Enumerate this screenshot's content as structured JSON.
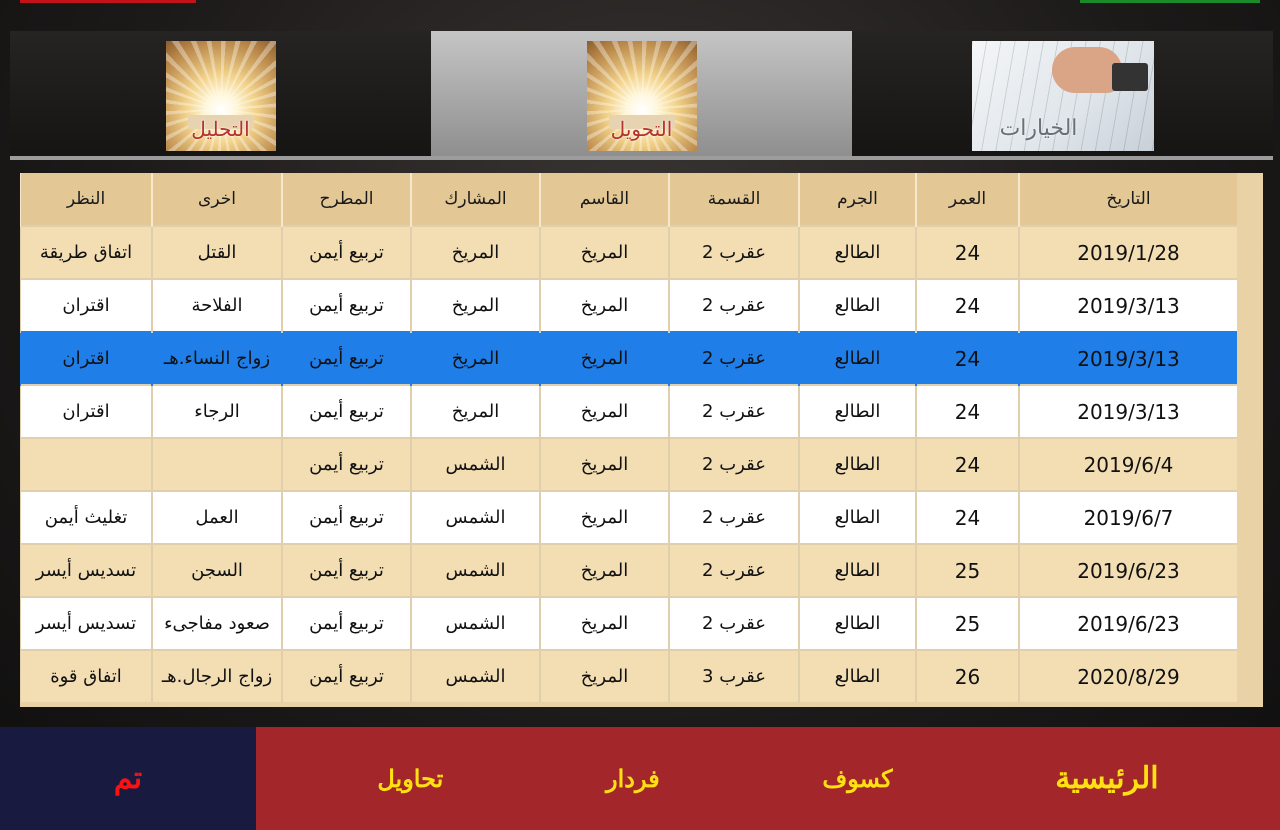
{
  "tabs": [
    {
      "label": "التحليل",
      "icon": "book-light-icon"
    },
    {
      "label": "التحويل",
      "icon": "book-light-icon"
    },
    {
      "label": "الخيارات",
      "icon": "drafting-hands-icon"
    }
  ],
  "table": {
    "columns": [
      "التاريخ",
      "العمر",
      "الجرم",
      "القسمة",
      "القاسم",
      "المشارك",
      "المطرح",
      "اخرى",
      "النظر"
    ],
    "rows": [
      [
        "2019/1/28",
        "24",
        "الطالع",
        "عقرب 2",
        "المريخ",
        "المريخ",
        "تربيع أيمن",
        "القتل",
        "اتفاق طريقة"
      ],
      [
        "2019/3/13",
        "24",
        "الطالع",
        "عقرب 2",
        "المريخ",
        "المريخ",
        "تربيع أيمن",
        "الفلاحة",
        "اقتران"
      ],
      [
        "2019/3/13",
        "24",
        "الطالع",
        "عقرب 2",
        "المريخ",
        "المريخ",
        "تربيع أيمن",
        "زواج النساء.هـ",
        "اقتران"
      ],
      [
        "2019/3/13",
        "24",
        "الطالع",
        "عقرب 2",
        "المريخ",
        "المريخ",
        "تربيع أيمن",
        "الرجاء",
        "اقتران"
      ],
      [
        "2019/6/4",
        "24",
        "الطالع",
        "عقرب 2",
        "المريخ",
        "الشمس",
        "تربيع أيمن",
        "",
        ""
      ],
      [
        "2019/6/7",
        "24",
        "الطالع",
        "عقرب 2",
        "المريخ",
        "الشمس",
        "تربيع أيمن",
        "العمل",
        "تغليث أيمن"
      ],
      [
        "2019/6/23",
        "25",
        "الطالع",
        "عقرب 2",
        "المريخ",
        "الشمس",
        "تربيع أيمن",
        "السجن",
        "تسديس أيسر"
      ],
      [
        "2019/6/23",
        "25",
        "الطالع",
        "عقرب 2",
        "المريخ",
        "الشمس",
        "تربيع أيمن",
        "صعود مفاجىء",
        "تسديس أيسر"
      ],
      [
        "2020/8/29",
        "26",
        "الطالع",
        "عقرب 3",
        "المريخ",
        "الشمس",
        "تربيع أيمن",
        "زواج الرجال.هـ",
        "اتفاق قوة"
      ]
    ],
    "selected_row": 2
  },
  "nav": {
    "home": "الرئيسية",
    "eclipse": "كسوف",
    "firdar": "فردار",
    "transits": "تحاويل",
    "done": "تم"
  },
  "colors": {
    "header_bg": "#e3c795",
    "row_odd": "#f3deb4",
    "row_even": "#ffffff",
    "row_selected": "#1f7ee8",
    "nav_bg": "#a2262a",
    "nav_text": "#ffe012",
    "done_bg": "#191a3f",
    "done_text": "#ff1010"
  }
}
